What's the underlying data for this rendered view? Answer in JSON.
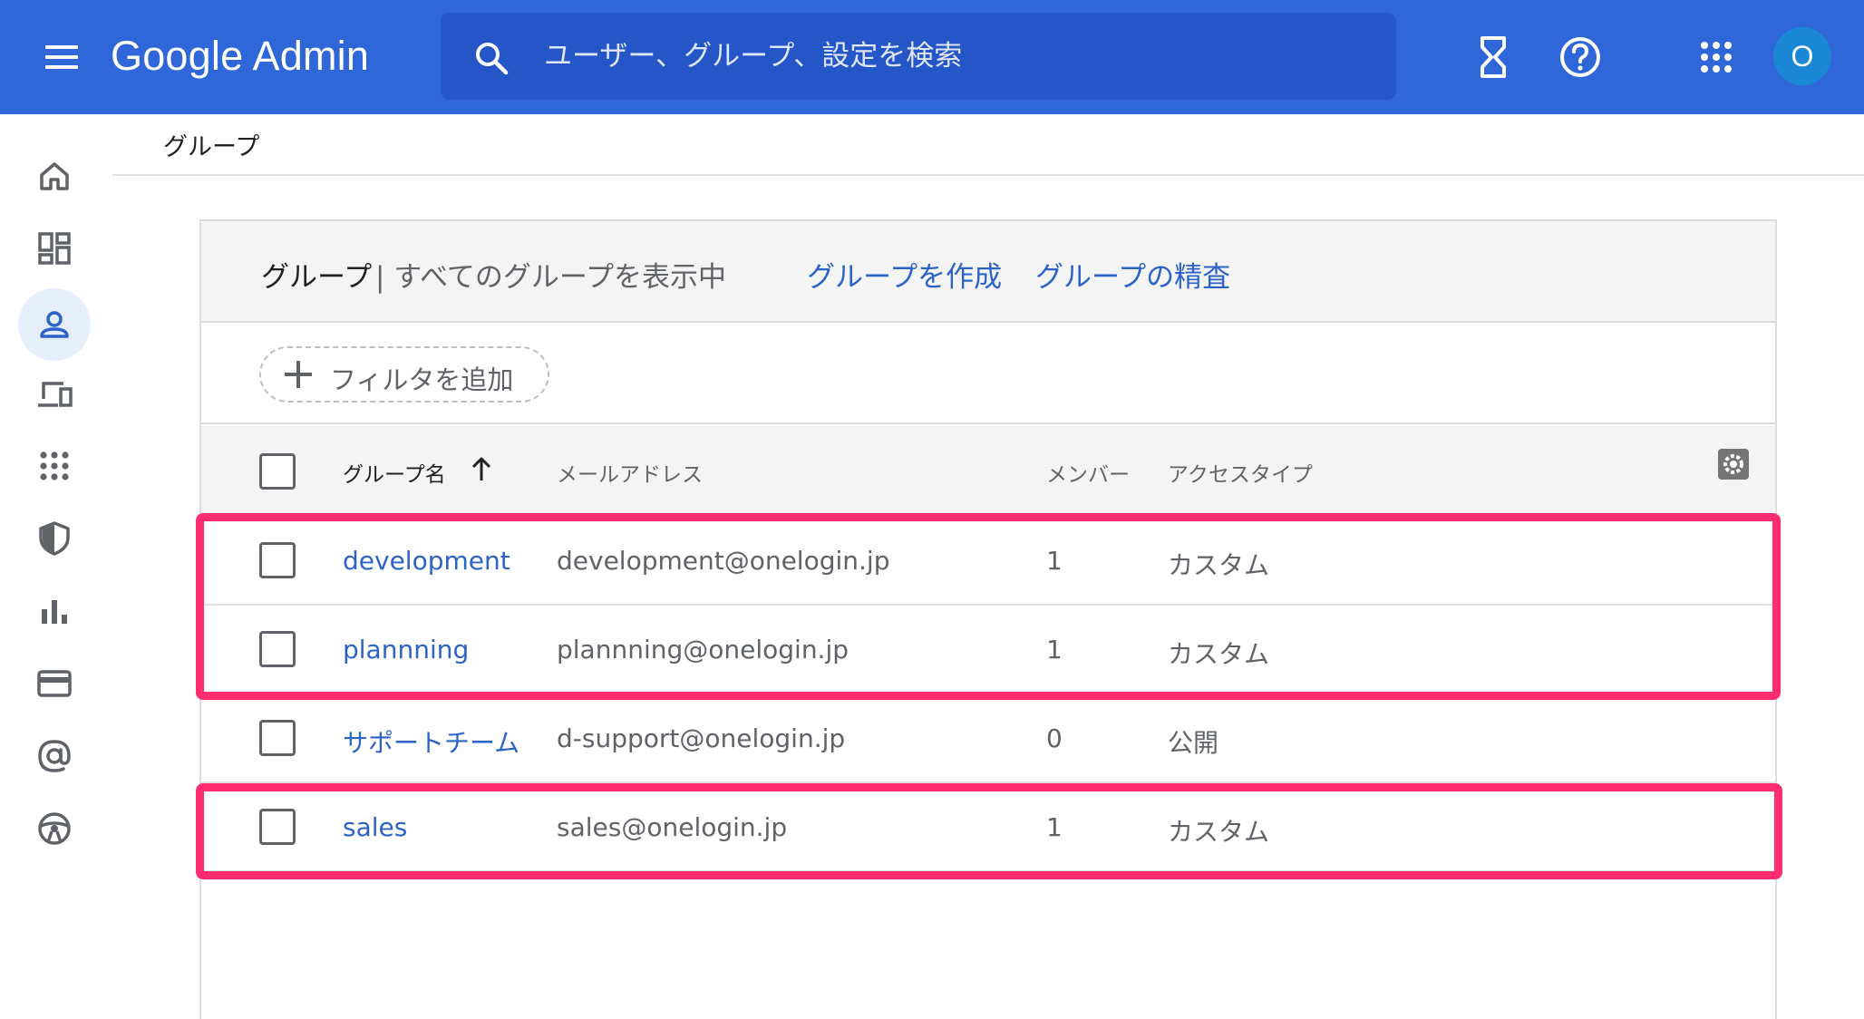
{
  "app": {
    "logo": "Google Admin",
    "avatar_letter": "O"
  },
  "search": {
    "placeholder": "ユーザー、グループ、設定を検索"
  },
  "breadcrumb": "グループ",
  "card": {
    "title": "グループ",
    "subtitle": " | すべてのグループを表示中",
    "create_group": "グループを作成",
    "inspect_groups": "グループの精査",
    "add_filter": "フィルタを追加"
  },
  "table": {
    "headers": {
      "name": "グループ名",
      "email": "メールアドレス",
      "members": "メンバー",
      "access": "アクセスタイプ"
    },
    "rows": [
      {
        "name": "development",
        "email": "development@onelogin.jp",
        "members": "1",
        "access": "カスタム"
      },
      {
        "name": "plannning",
        "email": "plannning@onelogin.jp",
        "members": "1",
        "access": "カスタム"
      },
      {
        "name": "サポートチーム",
        "email": "d-support@onelogin.jp",
        "members": "0",
        "access": "公開"
      },
      {
        "name": "sales",
        "email": "sales@onelogin.jp",
        "members": "1",
        "access": "カスタム"
      }
    ]
  },
  "colors": {
    "topbar": "#2f66d8",
    "link": "#2c63c9",
    "highlight": "#ff2d6f",
    "active_nav_bg": "#e6eefc"
  },
  "icons": {
    "top": [
      "hourglass-icon",
      "help-icon",
      "apps-grid-icon"
    ],
    "sidebar": [
      "home-icon",
      "dashboard-icon",
      "users-icon",
      "devices-icon",
      "apps-icon",
      "security-icon",
      "reports-icon",
      "billing-icon",
      "domains-icon",
      "rules-icon"
    ]
  }
}
